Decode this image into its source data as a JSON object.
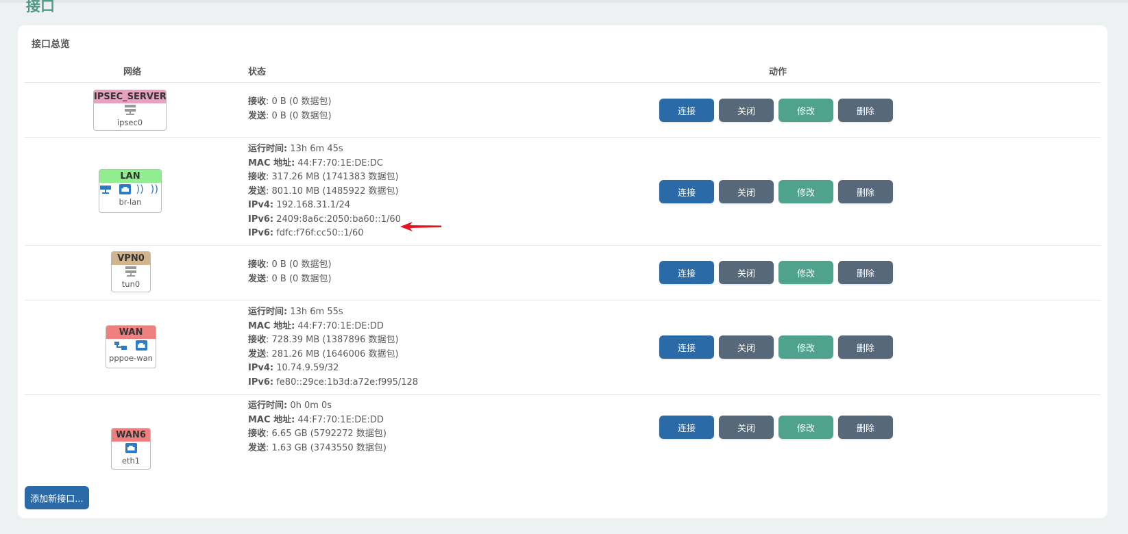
{
  "page": {
    "title": "接口"
  },
  "card": {
    "title": "接口总览"
  },
  "columns": {
    "network": "网络",
    "status": "状态",
    "action": "动作"
  },
  "buttons": {
    "connect": "连接",
    "close": "关闭",
    "edit": "修改",
    "delete": "删除",
    "add": "添加新接口..."
  },
  "colors": {
    "ipsec": "#e8a2c0",
    "lan": "#90ee90",
    "vpn": "#d2b48c",
    "wan": "#f08080",
    "connect": "#2a6aa6",
    "close": "#56687a",
    "edit": "#4fa28d",
    "arrow": "#e8121c"
  },
  "interfaces": [
    {
      "name": "IPSEC_SERVER",
      "device": "ipsec0",
      "icons": [
        "server-icon"
      ],
      "status": [
        {
          "label": "接收",
          "value": ": 0 B (0 数据包)"
        },
        {
          "label": "发送",
          "value": ": 0 B (0 数据包)"
        }
      ]
    },
    {
      "name": "LAN",
      "device": "br-lan",
      "icons": [
        "bridge-icon",
        "ethernet-icon",
        "wifi-icon",
        "wifi-icon"
      ],
      "status": [
        {
          "label": "运行时间:",
          "value": " 13h 6m 45s"
        },
        {
          "label": "MAC 地址:",
          "value": " 44:F7:70:1E:DE:DC"
        },
        {
          "label": "接收",
          "value": ": 317.26 MB (1741383 数据包)"
        },
        {
          "label": "发送",
          "value": ": 801.10 MB (1485922 数据包)"
        },
        {
          "label": "IPv4:",
          "value": " 192.168.31.1/24"
        },
        {
          "label": "IPv6:",
          "value": " 2409:8a6c:2050:ba60::1/60"
        },
        {
          "label": "IPv6:",
          "value": " fdfc:f76f:cc50::1/60"
        }
      ]
    },
    {
      "name": "VPN0",
      "device": "tun0",
      "icons": [
        "server-icon"
      ],
      "status": [
        {
          "label": "接收",
          "value": ": 0 B (0 数据包)"
        },
        {
          "label": "发送",
          "value": ": 0 B (0 数据包)"
        }
      ]
    },
    {
      "name": "WAN",
      "device": "pppoe-wan",
      "icons": [
        "pppoe-icon",
        "ethernet-icon"
      ],
      "status": [
        {
          "label": "运行时间:",
          "value": " 13h 6m 55s"
        },
        {
          "label": "MAC 地址:",
          "value": " 44:F7:70:1E:DE:DD"
        },
        {
          "label": "接收",
          "value": ": 728.39 MB (1387896 数据包)"
        },
        {
          "label": "发送",
          "value": ": 281.26 MB (1646006 数据包)"
        },
        {
          "label": "IPv4:",
          "value": " 10.74.9.59/32"
        },
        {
          "label": "IPv6:",
          "value": " fe80::29ce:1b3d:a72e:f995/128"
        }
      ]
    },
    {
      "name": "WAN6",
      "device": "eth1",
      "icons": [
        "ethernet-icon"
      ],
      "status": [
        {
          "label": "运行时间:",
          "value": " 0h 0m 0s"
        },
        {
          "label": "MAC 地址:",
          "value": " 44:F7:70:1E:DE:DD"
        },
        {
          "label": "接收",
          "value": ": 6.65 GB (5792272 数据包)"
        },
        {
          "label": "发送",
          "value": ": 1.63 GB (3743550 数据包)"
        }
      ]
    }
  ]
}
